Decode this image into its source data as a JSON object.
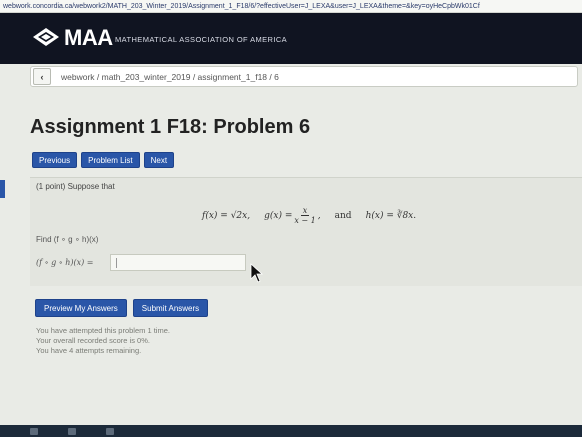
{
  "browser": {
    "url": "webwork.concordia.ca/webwork2/MATH_203_Winter_2019/Assignment_1_F18/6/?effectiveUser=J_LEXA&user=J_LEXA&theme=&key=oyHeCpbWk01Cf"
  },
  "header": {
    "logo_text": "MAA",
    "org_name": "MATHEMATICAL ASSOCIATION OF AMERICA"
  },
  "breadcrumb": {
    "back_symbol": "‹",
    "path": "webwork / math_203_winter_2019 / assignment_1_f18 / 6"
  },
  "page": {
    "title": "Assignment 1 F18: Problem 6"
  },
  "nav": {
    "previous": "Previous",
    "problem_list": "Problem List",
    "next": "Next"
  },
  "problem": {
    "intro": "(1 point) Suppose that",
    "f_def": "f(x) = √2x,",
    "g_lhs": "g(x) =",
    "g_num": "x",
    "g_den": "x − 1",
    "g_comma": ",",
    "and": "and",
    "h_def": "h(x) = ∛8x.",
    "find": "Find (f ∘ g ∘ h)(x)",
    "answer_label": "(f ∘ g ∘ h)(x) =",
    "answer_value": ""
  },
  "actions": {
    "preview": "Preview My Answers",
    "submit": "Submit Answers"
  },
  "status": {
    "attempted": "You have attempted this problem 1 time.",
    "score": "Your overall recorded score is 0%.",
    "remaining": "You have 4 attempts remaining."
  },
  "colors": {
    "header_bg": "#101421",
    "button_blue": "#2a56a8"
  }
}
